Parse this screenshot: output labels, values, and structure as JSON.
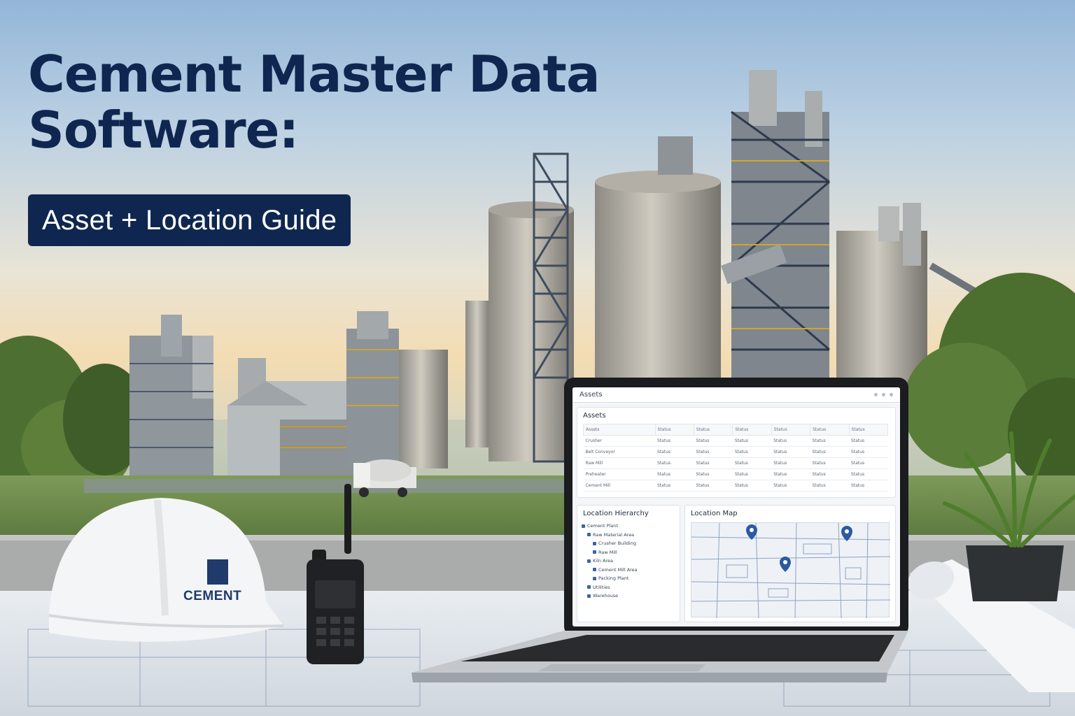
{
  "headline": {
    "line1": "Cement Master Data",
    "line2": "Software:",
    "subtitle": "Asset + Location Guide"
  },
  "helmet": {
    "label": "CEMENT"
  },
  "laptop_app": {
    "window_title": "Assets",
    "assets_panel": {
      "title": "Assets",
      "columns": [
        "Assets",
        "Status",
        "Status",
        "Status",
        "Status",
        "Status",
        "Status"
      ],
      "rows": [
        [
          "Crusher",
          "Status",
          "Status",
          "Status",
          "Status",
          "Status",
          "Status"
        ],
        [
          "Belt Conveyor",
          "Status",
          "Status",
          "Status",
          "Status",
          "Status",
          "Status"
        ],
        [
          "Raw Mill",
          "Status",
          "Status",
          "Status",
          "Status",
          "Status",
          "Status"
        ],
        [
          "Preheater",
          "Status",
          "Status",
          "Status",
          "Status",
          "Status",
          "Status"
        ],
        [
          "Cement Mill",
          "Status",
          "Status",
          "Status",
          "Status",
          "Status",
          "Status"
        ]
      ]
    },
    "hierarchy_panel": {
      "title": "Location Hierarchy",
      "items": [
        {
          "label": "Cement Plant",
          "level": 0
        },
        {
          "label": "Raw Material Area",
          "level": 1
        },
        {
          "label": "Crusher Building",
          "level": 2
        },
        {
          "label": "Raw Mill",
          "level": 2
        },
        {
          "label": "Kiln Area",
          "level": 1
        },
        {
          "label": "Cement Mill Area",
          "level": 2
        },
        {
          "label": "Packing Plant",
          "level": 2
        },
        {
          "label": "Utilities",
          "level": 1
        },
        {
          "label": "Warehouse",
          "level": 1
        }
      ]
    },
    "map_panel": {
      "title": "Location Map",
      "pins": 3
    }
  },
  "colors": {
    "brand_navy": "#0f2750",
    "pin_blue": "#2c5aa0"
  }
}
